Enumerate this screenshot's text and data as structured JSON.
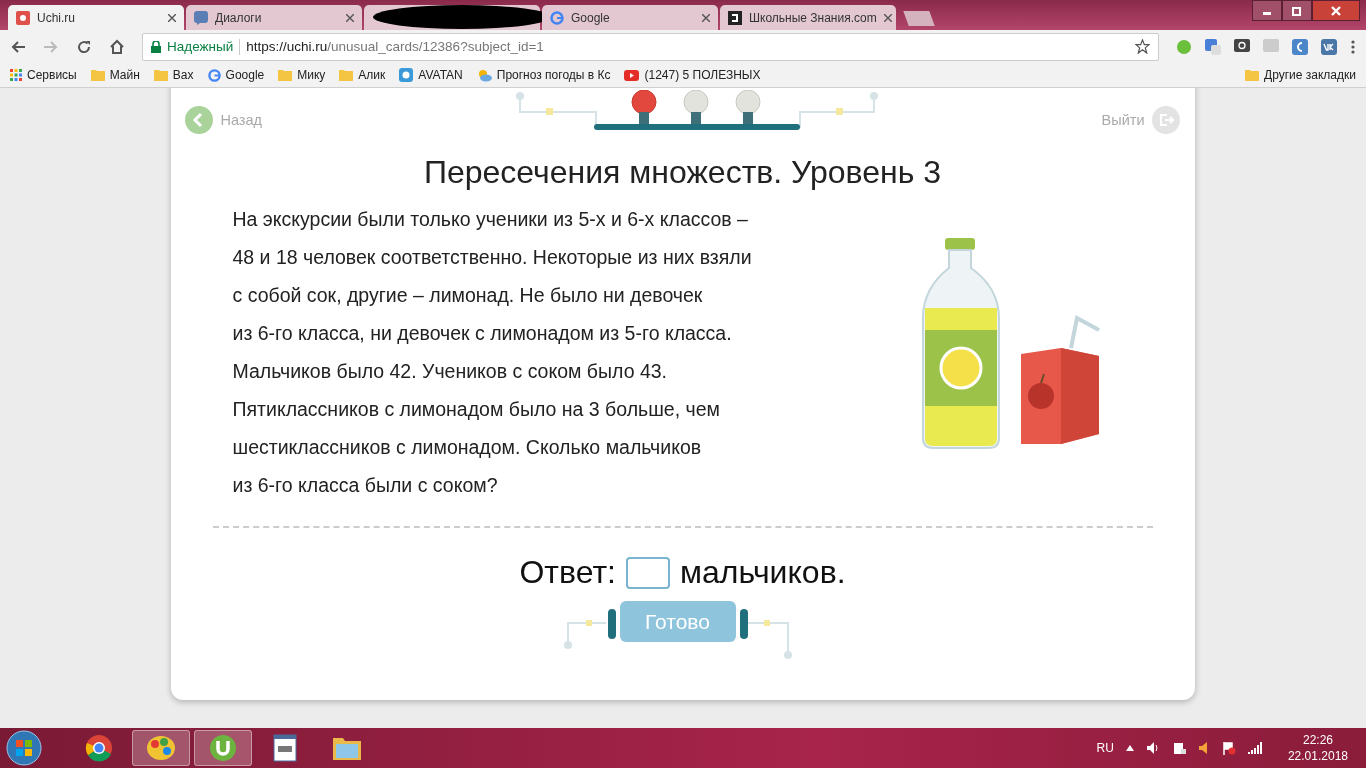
{
  "browser": {
    "tabs": [
      {
        "title": "Uchi.ru",
        "selected": true,
        "kind": "uchi"
      },
      {
        "title": "Диалоги",
        "selected": false,
        "kind": "chat"
      },
      {
        "selected": false,
        "kind": "hidden"
      },
      {
        "title": "Google",
        "selected": false,
        "kind": "google"
      },
      {
        "title": "Школьные Знания.com",
        "selected": false,
        "kind": "znania"
      }
    ],
    "address": {
      "security": "Надежный",
      "url_host": "https://uchi.ru",
      "url_path": "/unusual_cards/12386?subject_id=1"
    },
    "bookmarks": [
      {
        "title": "Сервисы",
        "kind": "apps"
      },
      {
        "title": "Майн",
        "kind": "folder"
      },
      {
        "title": "Вах",
        "kind": "folder"
      },
      {
        "title": "Google",
        "kind": "google"
      },
      {
        "title": "Мику",
        "kind": "folder"
      },
      {
        "title": "Алик",
        "kind": "folder"
      },
      {
        "title": "AVATAN",
        "kind": "avatan"
      },
      {
        "title": "Прогноз погоды в Кс",
        "kind": "weather"
      },
      {
        "title": "(1247) 5 ПОЛЕЗНЫХ",
        "kind": "youtube"
      }
    ],
    "other_bookmarks": "Другие закладки"
  },
  "page": {
    "back": "Назад",
    "exit": "Выйти",
    "lamps": [
      {
        "lit": true
      },
      {
        "lit": false
      },
      {
        "lit": false
      }
    ],
    "title": "Пересечения множеств. Уровень 3",
    "problem_lines": [
      "На экскурсии были только ученики из 5-х и 6-х классов –",
      "48 и 18 человек соответственно. Некоторые из них взяли",
      "с собой сок, другие – лимонад. Не было ни девочек",
      "из 6-го класса, ни девочек с лимонадом из 5-го класса.",
      "Мальчиков было 42. Учеников с соком было 43.",
      "Пятиклассников с лимонадом было на 3 больше, чем",
      "шестиклассников с лимонадом. Сколько мальчиков",
      "из 6-го класса были с соком?"
    ],
    "answer": {
      "label": "Ответ:",
      "unit": "мальчиков."
    },
    "submit": {
      "label": "Готово",
      "disabled": true
    }
  },
  "taskbar": {
    "apps": [
      {
        "kind": "chrome",
        "selected": false
      },
      {
        "kind": "paint",
        "selected": true
      },
      {
        "kind": "torrent",
        "selected": true
      },
      {
        "kind": "notepad",
        "selected": false
      },
      {
        "kind": "explorer",
        "selected": false
      }
    ],
    "language": "RU",
    "time": "22:26",
    "date": "22.01.2018"
  }
}
